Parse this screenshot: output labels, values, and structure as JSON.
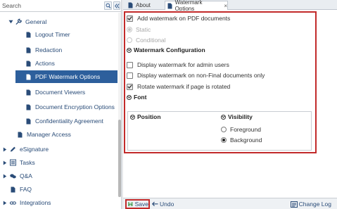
{
  "search": {
    "placeholder": "Search"
  },
  "tree": {
    "general": "General",
    "logout_timer": "Logout Timer",
    "redaction": "Redaction",
    "actions": "Actions",
    "pdf_watermark": "PDF Watermark Options",
    "document_viewers": "Document Viewers",
    "document_encryption": "Document Encryption Options",
    "confidentiality": "Confidentiality Agreement",
    "manager_access": "Manager Access",
    "esignature": "eSignature",
    "tasks": "Tasks",
    "qa": "Q&A",
    "faq": "FAQ",
    "integrations": "Integrations"
  },
  "tabs": {
    "about": "About",
    "watermark": "Watermark Options",
    "close_glyph": "×"
  },
  "content": {
    "add_watermark": "Add watermark on PDF documents",
    "static": "Static",
    "conditional": "Conditional",
    "watermark_config": "Watermark Configuration",
    "admin_users": "Display watermark for admin users",
    "non_final": "Display watermark on non-Final documents only",
    "rotate": "Rotate watermark if page is rotated",
    "font": "Font",
    "position": "Position",
    "visibility": "Visibility",
    "foreground": "Foreground",
    "background": "Background"
  },
  "footer": {
    "save": "Save",
    "undo": "Undo",
    "change_log": "Change Log"
  },
  "colors": {
    "selected_item": "#2d5f9c",
    "link": "#2a4c78",
    "highlight_frame": "#c22a2a"
  }
}
